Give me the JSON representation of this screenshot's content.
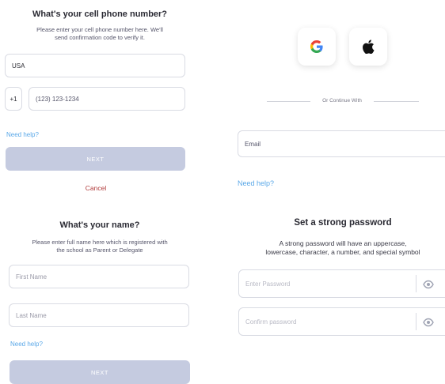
{
  "phone_screen": {
    "title": "What's your cell phone number?",
    "subtitle_line1": "Please enter your cell phone number here. We'll",
    "subtitle_line2": "send confirmation code to verify it.",
    "country_value": "USA",
    "dial_code": "+1",
    "phone_placeholder": "(123) 123-1234",
    "help_link": "Need help?",
    "next_label": "NEXT",
    "cancel_label": "Cancel"
  },
  "name_screen": {
    "title": "What's your name?",
    "subtitle_line1": "Please enter full name here which is registered with",
    "subtitle_line2": "the school as Parent or Delegate",
    "first_name_placeholder": "First Name",
    "last_name_placeholder": "Last Name",
    "help_link": "Need help?",
    "next_label": "NEXT"
  },
  "login_screen": {
    "google_icon": "google-icon",
    "apple_icon": "apple-icon",
    "divider_text": "Or Continue With",
    "email_placeholder": "Email",
    "help_link": "Need help?"
  },
  "password_screen": {
    "title": "Set a strong password",
    "subtitle_line1": "A strong password will have an uppercase,",
    "subtitle_line2": "lowercase, character, a number, and special symbol",
    "password_placeholder": "Enter Password",
    "confirm_placeholder": "Confirm password",
    "eye_icon": "eye-icon"
  },
  "colors": {
    "link": "#5aa8e8",
    "button_disabled": "#c5cbe0",
    "cancel": "#b03a3a"
  }
}
